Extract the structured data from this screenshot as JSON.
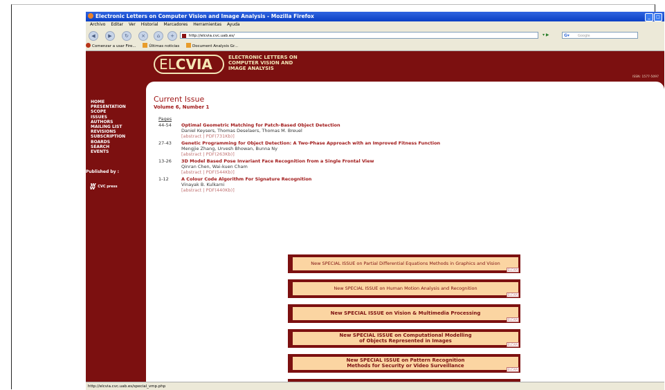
{
  "window": {
    "title": "Electronic Letters on Computer Vision and Image Analysis - Mozilla Firefox"
  },
  "menu": [
    "Archivo",
    "Editar",
    "Ver",
    "Historial",
    "Marcadores",
    "Herramientas",
    "Ayuda"
  ],
  "address": {
    "url": "http://elcvia.cvc.uab.es/",
    "search_placeholder": "Google"
  },
  "bookmarks": [
    "Comenzar a usar Fire...",
    "Últimas noticias",
    "Document Analysis Gr..."
  ],
  "site": {
    "logo_light": "EL",
    "logo_bold": "CVIA",
    "tagline": [
      "ELECTRONIC LETTERS ON",
      "COMPUTER VISION AND",
      "IMAGE ANALYSIS"
    ],
    "issn": "ISSN: 1577-5097",
    "nav": [
      "HOME",
      "PRESENTATION",
      "SCOPE",
      "ISSUES",
      "AUTHORS",
      "MAILING LIST",
      "REVISIONS",
      "SUBSCRIPTION",
      "BOARDS",
      "SEARCH",
      "EVENTS"
    ],
    "published_by": "Published by :",
    "publisher": "CVC press"
  },
  "issue": {
    "title": "Current Issue",
    "volume": "Volume 6, Number 1",
    "pages_label": "Pages",
    "articles": [
      {
        "pages": "44-54",
        "title": "Optimal Geometric Matching for Patch-Based Object Detection",
        "authors": "Daniel Keysers, Thomas Deselaers, Thomas M. Breuel",
        "links": "[abstract | PDF(731Kb)]"
      },
      {
        "pages": "27-43",
        "title": "Genetic Programming for Object Detection: A Two-Phase Approach with an Improved Fitness Function",
        "authors": "Mengjie Zhang, Urvesh Bhowan, Bunna Ny",
        "links": "[abstract | PDF(263Kb)]"
      },
      {
        "pages": "13-26",
        "title": "3D Model Based Pose Invariant Face Recognition from a Single Frontal View",
        "authors": "Qinran Chen, Wai-kuen Cham",
        "links": "[abstract | PDF(544Kb)]"
      },
      {
        "pages": "1-12",
        "title": "A Colour Code Algorithm For Signature Recognition",
        "authors": "Vinayak B. Kulkarni",
        "links": "[abstract | PDF(440Kb)]"
      }
    ]
  },
  "banners": [
    {
      "text": "New SPECIAL ISSUE on Partial Differential Equations Methods in Graphics and Vision",
      "stamp": "ELCVIA"
    },
    {
      "text": "New SPECIAL ISSUE on Human Motion Analysis and Recognition",
      "stamp": "ELCVIA"
    },
    {
      "text": "New SPECIAL ISSUE on Vision & Multimedia Processing",
      "stamp": "ELCVIA"
    },
    {
      "line1": "New SPECIAL ISSUE on Computational Modelling",
      "line2": "of Objects Represented in Images",
      "stamp": "ELCVIA"
    },
    {
      "line1": "New SPECIAL ISSUE on Pattern Recognition",
      "line2": "Methods for Security or Video Surveillance",
      "stamp": "ELCVIA"
    }
  ],
  "status": {
    "text": "http://elcvia.cvc.uab.es/special_vmp.php"
  }
}
